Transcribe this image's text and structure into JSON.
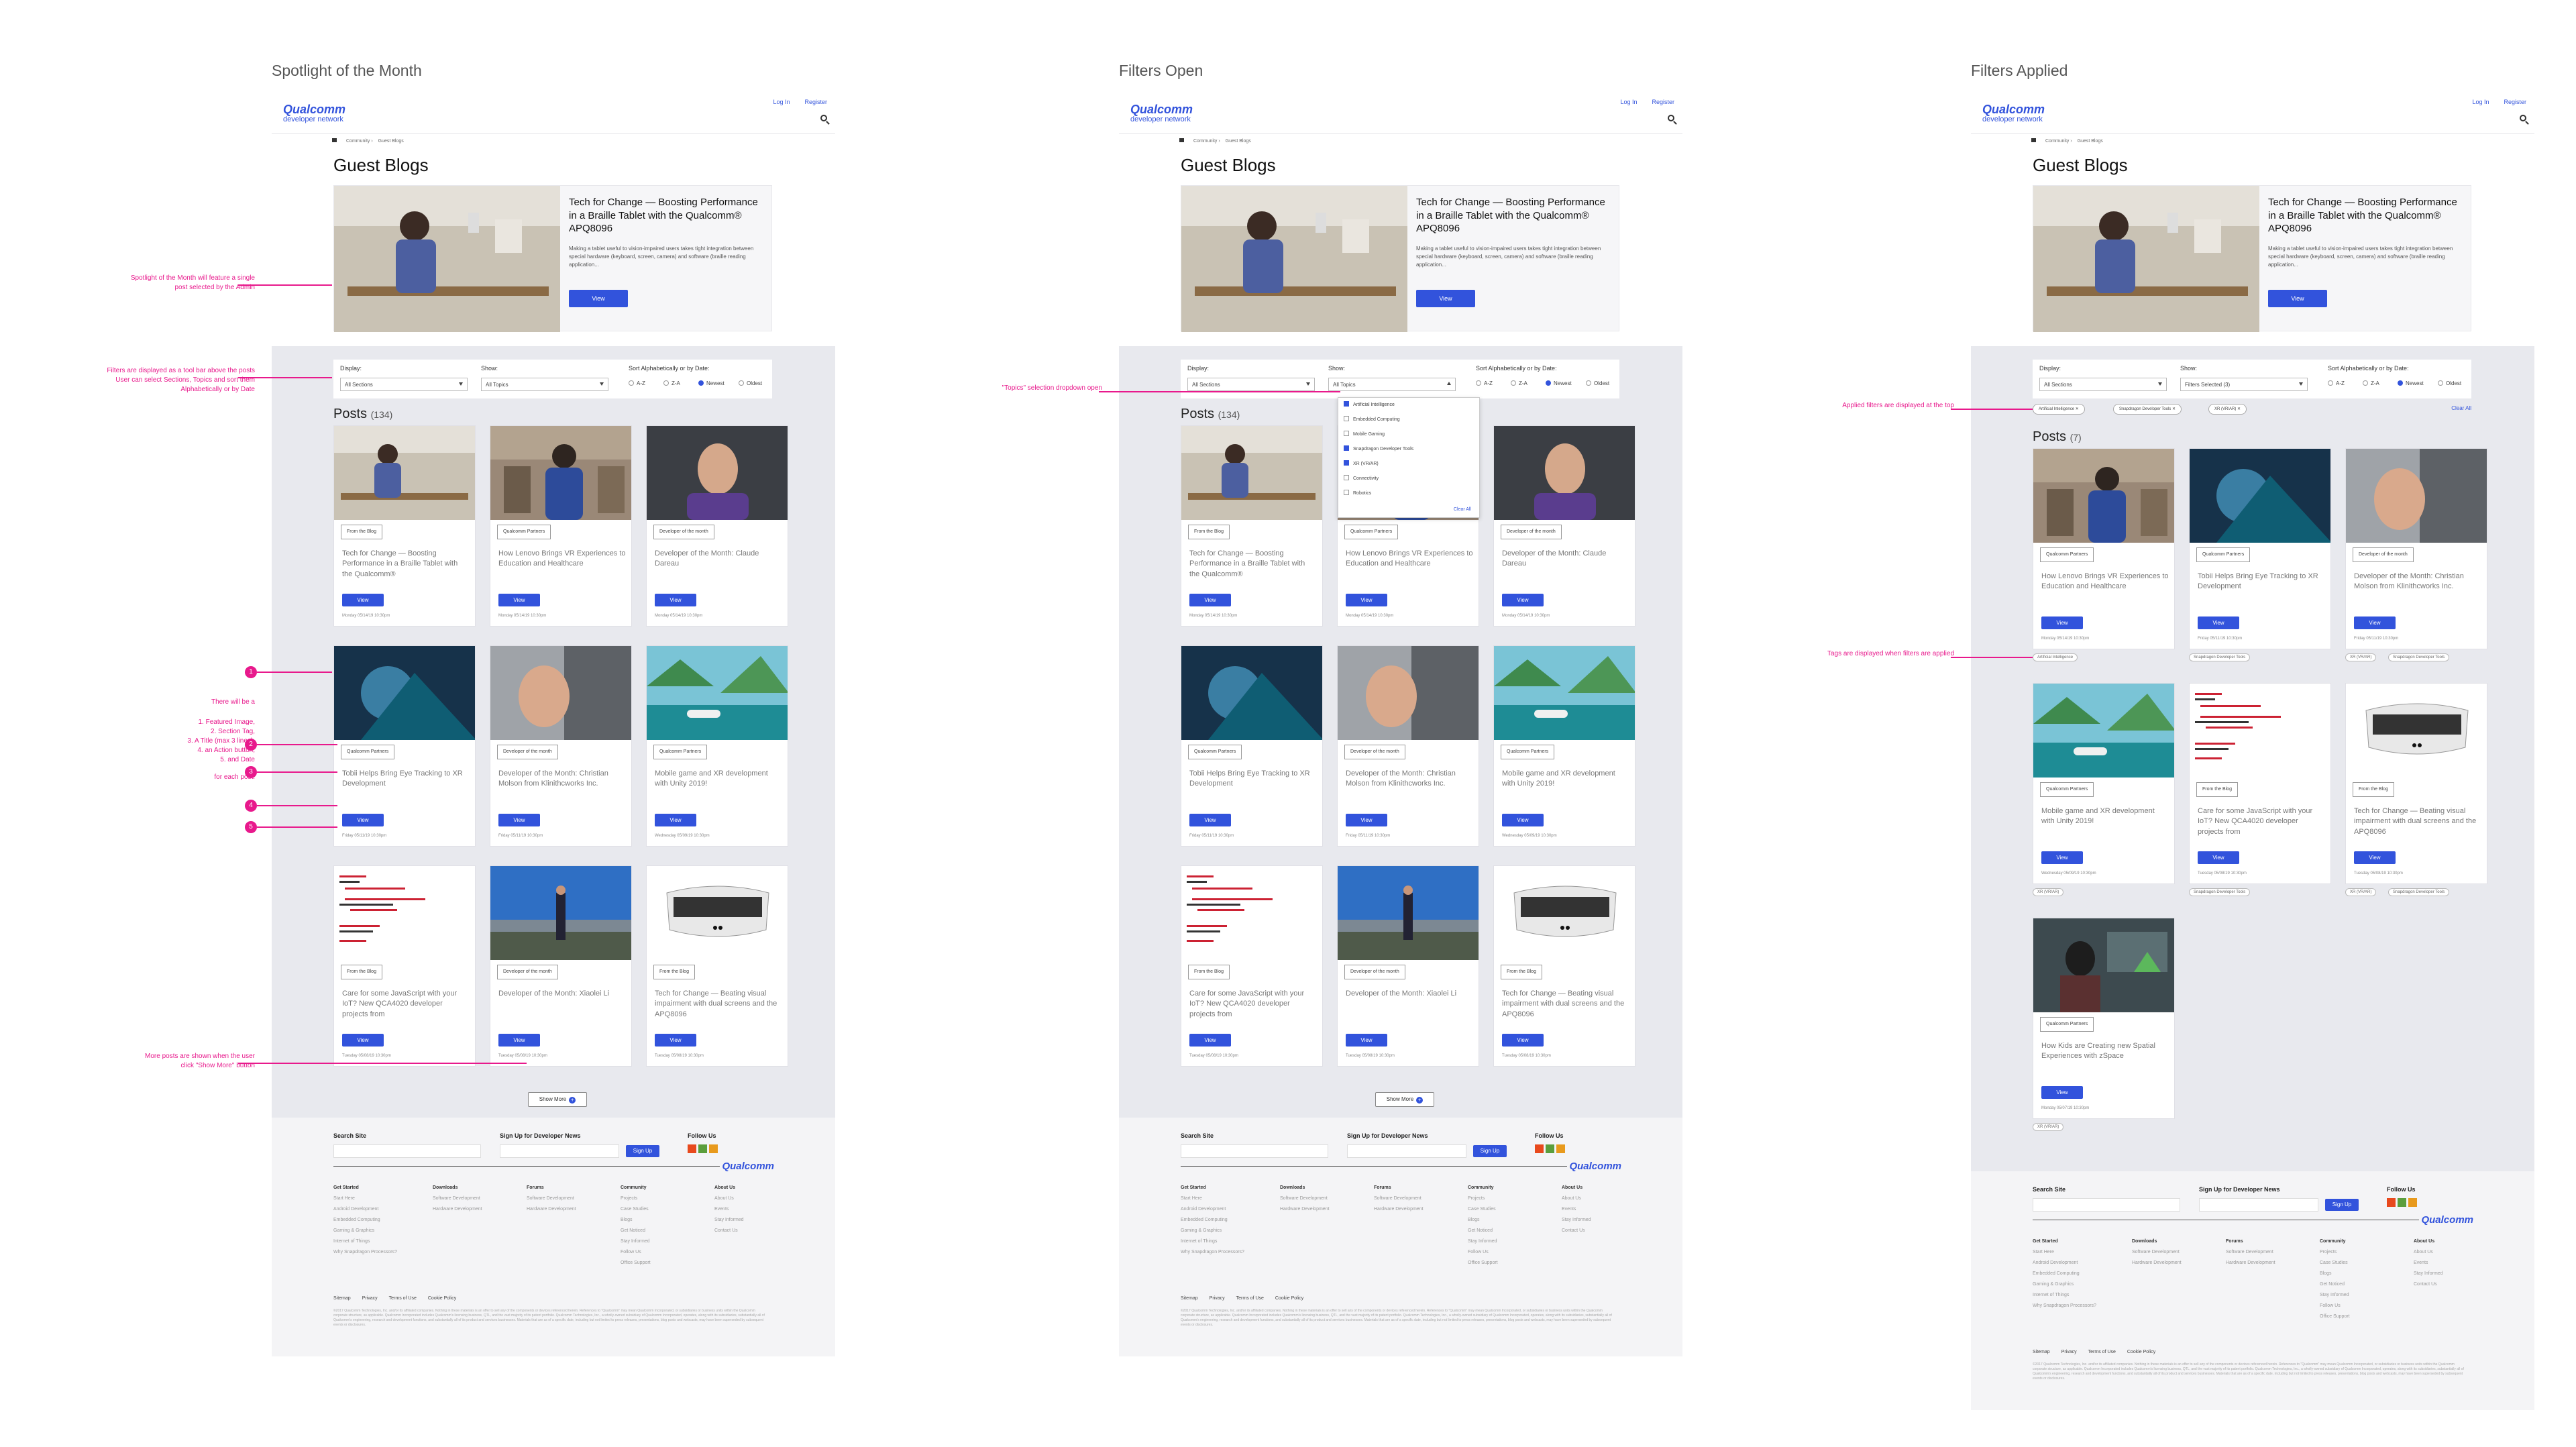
{
  "columns": [
    {
      "title": "Spotlight of the Month"
    },
    {
      "title": "Filters Open"
    },
    {
      "title": "Filters Applied"
    }
  ],
  "site": {
    "logo": "Qualcomm",
    "logo_sub": "developer network",
    "login": "Log In",
    "register": "Register",
    "breadcrumb": [
      "Community",
      "Guest Blogs"
    ],
    "page_title": "Guest Blogs"
  },
  "spotlight": {
    "title": "Tech for Change — Boosting Performance in a Braille Tablet with the Qualcomm® APQ8096",
    "desc": "Making a tablet useful to vision-impaired users takes tight integration between special hardware (keyboard, screen, camera) and software (braille reading application...",
    "button": "View"
  },
  "filters": {
    "display_label": "Display:",
    "display_value": "All Sections",
    "show_label": "Show:",
    "show_value": "All Topics",
    "show_value_applied": "Filters Selected (3)",
    "sort_label": "Sort Alphabetically or by Date:",
    "sort_options": [
      "A-Z",
      "Z-A",
      "Newest",
      "Oldest"
    ]
  },
  "dropdown": {
    "options": [
      "Artificial Intelligence",
      "Embedded Computing",
      "Mobile Gaming",
      "Snapdragon Developer Tools",
      "XR (VR/AR)",
      "Connectivity",
      "Robotics"
    ],
    "checked": [
      true,
      false,
      false,
      true,
      true,
      false,
      false
    ],
    "clear": "Clear All"
  },
  "applied": {
    "chips": [
      "Artificial Intelligence ✕",
      "Snapdragon Developer Tools ✕",
      "XR (VR/AR) ✕"
    ],
    "clear": "Clear All",
    "posts_count": "(7)"
  },
  "posts": {
    "heading": "Posts",
    "count": "(134)",
    "view": "View",
    "show_more": "Show More",
    "more_icon": "+"
  },
  "cards": [
    {
      "tag": "From the Blog",
      "title": "Tech for Change — Boosting Performance in a Braille Tablet with the Qualcomm®",
      "date": "Monday 05/14/19 10:30pm"
    },
    {
      "tag": "Qualcomm Partners",
      "title": "How Lenovo Brings VR Experiences to Education and Healthcare",
      "date": "Monday 05/14/19 10:30pm"
    },
    {
      "tag": "Developer of the month",
      "title": "Developer of the Month: Claude Dareau",
      "date": "Monday 05/14/19 10:30pm"
    },
    {
      "tag": "Qualcomm Partners",
      "title": "Tobii Helps Bring Eye Tracking to XR Development",
      "date": "Friday 05/11/19 10:30pm"
    },
    {
      "tag": "Developer of the month",
      "title": "Developer of the Month: Christian Molson from Klinithcworks Inc.",
      "date": "Friday 05/11/19 10:30pm"
    },
    {
      "tag": "Qualcomm Partners",
      "title": "Mobile game and XR development with Unity 2019!",
      "date": "Wednesday 05/09/19 10:30pm"
    },
    {
      "tag": "From the Blog",
      "title": "Care for some JavaScript with your IoT? New QCA4020 developer projects from",
      "date": "Tuesday 05/08/19 10:30pm"
    },
    {
      "tag": "Developer of the month",
      "title": "Developer of the Month: Xiaolei Li",
      "date": "Tuesday 05/08/19 10:30pm"
    },
    {
      "tag": "From the Blog",
      "title": "Tech for Change — Beating visual impairment with dual screens and the APQ8096",
      "date": "Tuesday 05/08/19 10:30pm"
    }
  ],
  "filtered_cards": [
    {
      "tag": "Qualcomm Partners",
      "title": "How Lenovo Brings VR Experiences to Education and Healthcare",
      "date": "Monday 05/14/19 10:30pm",
      "tags": [
        "Artificial Intelligence"
      ]
    },
    {
      "tag": "Qualcomm Partners",
      "title": "Tobii Helps Bring Eye Tracking to XR Development",
      "date": "Friday 05/11/19 10:30pm",
      "tags": [
        "Snapdragon Developer Tools"
      ]
    },
    {
      "tag": "Developer of the month",
      "title": "Developer of the Month: Christian Molson from Klinithcworks Inc.",
      "date": "Friday 05/11/19 10:30pm",
      "tags": [
        "XR (VR/AR)",
        "Snapdragon Developer Tools"
      ]
    },
    {
      "tag": "Qualcomm Partners",
      "title": "Mobile game and XR development with Unity 2019!",
      "date": "Wednesday 05/09/19 10:30pm",
      "tags": [
        "XR (VR/AR)"
      ]
    },
    {
      "tag": "From the Blog",
      "title": "Care for some JavaScript with your IoT? New QCA4020 developer projects from",
      "date": "Tuesday 05/08/19 10:30pm",
      "tags": [
        "Snapdragon Developer Tools"
      ]
    },
    {
      "tag": "From the Blog",
      "title": "Tech for Change — Beating visual impairment with dual screens and the APQ8096",
      "date": "Tuesday 05/08/19 10:30pm",
      "tags": [
        "XR (VR/AR)",
        "Snapdragon Developer Tools"
      ]
    },
    {
      "tag": "Qualcomm Partners",
      "title": "How Kids are Creating new Spatial Experiences with zSpace",
      "date": "Monday 05/07/19 10:30pm",
      "tags": [
        "XR (VR/AR)"
      ]
    }
  ],
  "footer": {
    "search_label": "Search Site",
    "news_label": "Sign Up for Developer News",
    "signup": "Sign Up",
    "follow": "Follow Us",
    "logo": "Qualcomm",
    "cols": [
      {
        "head": "Get Started",
        "items": [
          "Start Here",
          "Android Development",
          "Embedded Computing",
          "Gaming & Graphics",
          "Internet of Things",
          "Why Snapdragon Processors?"
        ]
      },
      {
        "head": "Downloads",
        "items": [
          "Software Development",
          "Hardware Development"
        ]
      },
      {
        "head": "Forums",
        "items": [
          "Software Development",
          "Hardware Development"
        ]
      },
      {
        "head": "Community",
        "items": [
          "Projects",
          "Case Studies",
          "Blogs",
          "Get Noticed",
          "Stay Informed",
          "Follow Us",
          "Office Support"
        ]
      },
      {
        "head": "About Us",
        "items": [
          "About Us",
          "Events",
          "Stay Informed",
          "Contact Us"
        ]
      }
    ],
    "links": [
      "Sitemap",
      "Privacy",
      "Terms of Use",
      "Cookie Policy"
    ],
    "legal": "©2017 Qualcomm Technologies, Inc. and/or its affiliated companies. Nothing in these materials is an offer to sell any of the components or devices referenced herein. References to \"Qualcomm\" may mean Qualcomm Incorporated, or subsidiaries or business units within the Qualcomm corporate structure, as applicable. Qualcomm Incorporated includes Qualcomm's licensing business, QTL, and the vast majority of its patent portfolio. Qualcomm Technologies, Inc., a wholly-owned subsidiary of Qualcomm Incorporated, operates, along with its subsidiaries, substantially all of Qualcomm's engineering, research and development functions, and substantially all of its product and services businesses. Materials that are as of a specific date, including but not limited to press releases, presentations, blog posts and webcasts, may have been superseded by subsequent events or disclosures."
  },
  "annotations": {
    "spotlight": "Spotlight of the Month will feature a single\npost selected by the Admin",
    "filters": "Filters are displayed as a tool bar above the posts\nUser can select Sections, Topics and sort them\nAlphabetically or by Date",
    "card_intro": "There will be a",
    "card_list": "1. Featured Image,\n2. Section Tag,\n3. A Title (max 3 lines),\n4. an Action button,\n5. and Date",
    "card_outro": "for each post.",
    "numbers": [
      "1",
      "2",
      "3",
      "4",
      "5"
    ],
    "more": "More posts are shown when the user\nclick \"Show More\" button",
    "topics": "\"Topics\" selection dropdown open",
    "applied": "Applied filters are displayed at the top",
    "tags": "Tags are displayed when filters are applied"
  }
}
